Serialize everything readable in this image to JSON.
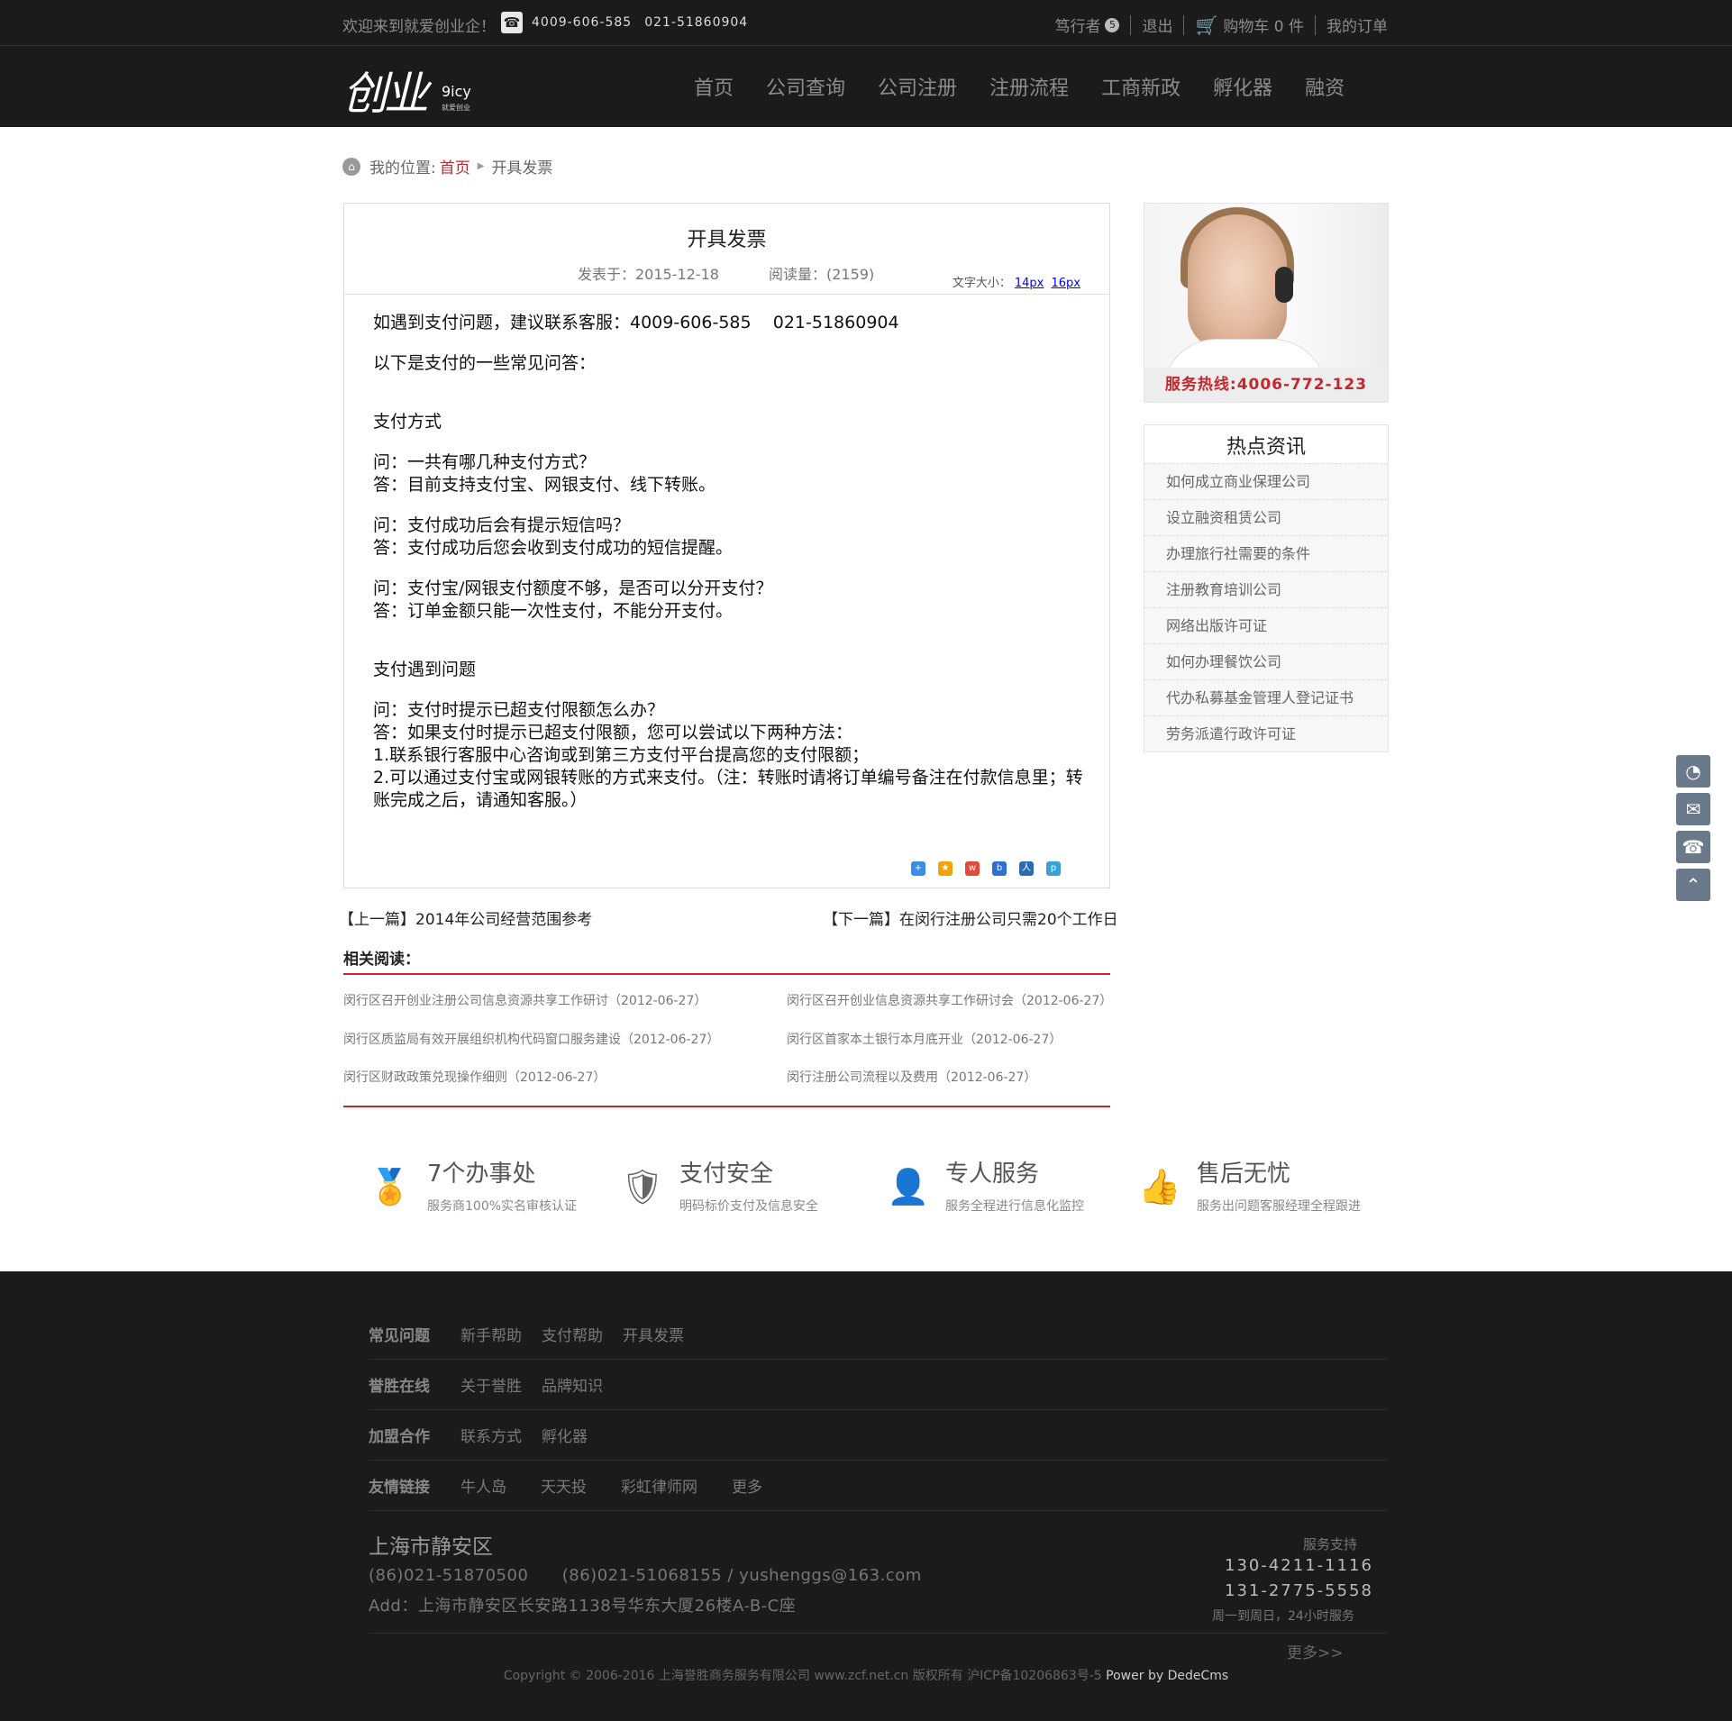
{
  "topbar": {
    "welcome": "欢迎来到就爱创业企！",
    "phone1": "4009-606-585",
    "phone2": "021-51860904",
    "user_name": "笃行者",
    "user_badge": "5",
    "logout": "退出",
    "cart": "购物车 0 件",
    "orders": "我的订单"
  },
  "logo": {
    "mark": "创业",
    "en": "9icy",
    "cn": "就爱创业"
  },
  "nav": [
    "首页",
    "公司查询",
    "公司注册",
    "注册流程",
    "工商新政",
    "孵化器",
    "融资"
  ],
  "breadcrumb": {
    "prefix": "我的位置:",
    "home": "首页",
    "current": "开具发票"
  },
  "article": {
    "title": "开具发票",
    "published": "发表于：2015-12-18",
    "views": "阅读量：(2159)",
    "font_size_label": "文字大小：",
    "font_small": "14px",
    "font_large": "16px",
    "body": [
      "如遇到支付问题，建议联系客服：4009-606-585    021-51860904",
      "",
      "以下是支付的一些常见问答：",
      "",
      "",
      "支付方式",
      "",
      "问：一共有哪几种支付方式？",
      "答：目前支持支付宝、网银支付、线下转账。",
      "",
      "问：支付成功后会有提示短信吗？",
      "答：支付成功后您会收到支付成功的短信提醒。",
      "",
      "问：支付宝/网银支付额度不够，是否可以分开支付？",
      "答：订单金额只能一次性支付，不能分开支付。",
      "",
      "",
      "支付遇到问题",
      "",
      "问：支付时提示已超支付限额怎么办？",
      "答：如果支付时提示已超支付限额，您可以尝试以下两种方法：",
      "1.联系银行客服中心咨询或到第三方支付平台提高您的支付限额；",
      "2.可以通过支付宝或网银转账的方式来支付。（注：转账时请将订单编号备注在付款信息里；转账完成之后，请通知客服。）"
    ]
  },
  "share_icons": [
    "plus-share-icon",
    "qzone-share-icon",
    "weibo-share-icon",
    "baidu-share-icon",
    "renren-share-icon",
    "pinterest-share-icon"
  ],
  "prev": "【上一篇】2014年公司经营范围参考",
  "next": "【下一篇】在闵行注册公司只需20个工作日",
  "related": {
    "title": "相关阅读：",
    "items": [
      "闵行区召开创业注册公司信息资源共享工作研讨（2012-06-27）",
      "闵行区召开创业信息资源共享工作研讨会（2012-06-27）",
      "闵行区质监局有效开展组织机构代码窗口服务建设（2012-06-27）",
      "闵行区首家本土银行本月底开业（2012-06-27）",
      "闵行区财政政策兑现操作细则（2012-06-27）",
      "闵行注册公司流程以及费用（2012-06-27）"
    ]
  },
  "sidebar": {
    "hotline": "服务热线:4006-772-123",
    "hot_title": "热点资讯",
    "hot_items": [
      "如何成立商业保理公司",
      "设立融资租赁公司",
      "办理旅行社需要的条件",
      "注册教育培训公司",
      "网络出版许可证",
      "如何办理餐饮公司",
      "代办私募基金管理人登记证书",
      "劳务派遣行政许可证"
    ]
  },
  "float_buttons": [
    "qq-icon",
    "wechat-icon",
    "telephone-icon",
    "back-to-top-icon"
  ],
  "features": [
    {
      "title": "7个办事处",
      "sub": "服务商100%实名审核认证",
      "icon": "award-medal-icon"
    },
    {
      "title": "支付安全",
      "sub": "明码标价支付及信息安全",
      "icon": "shield-check-icon"
    },
    {
      "title": "专人服务",
      "sub": "服务全程进行信息化监控",
      "icon": "user-icon"
    },
    {
      "title": "售后无忧",
      "sub": "服务出问题客服经理全程跟进",
      "icon": "thumbs-up-icon"
    }
  ],
  "footer": {
    "rows": [
      {
        "heading": "常见问题",
        "links": [
          "新手帮助",
          "支付帮助",
          "开具发票"
        ]
      },
      {
        "heading": "誉胜在线",
        "links": [
          "关于誉胜",
          "品牌知识"
        ]
      },
      {
        "heading": "加盟合作",
        "links": [
          "联系方式",
          "孵化器"
        ]
      },
      {
        "heading": "友情链接",
        "links": [
          "牛人岛",
          "天天投",
          "彩虹律师网",
          "更多"
        ]
      }
    ],
    "city": "上海市静安区",
    "contact": "(86)021-51870500      (86)021-51068155 / yushenggs@163.com",
    "address": "Add：上海市静安区长安路1138号华东大厦26楼A-B-C座",
    "support_title": "服务支持",
    "support_phone1": "130-4211-1116",
    "support_phone2": "131-2775-5558",
    "support_note": "周一到周日，24小时服务",
    "more": "更多>>",
    "copyright": "Copyright © 2006-2016 上海誉胜商务服务有限公司 www.zcf.net.cn  版权所有  沪ICP备10206863号-5 ",
    "power": "Power by DedeCms"
  }
}
